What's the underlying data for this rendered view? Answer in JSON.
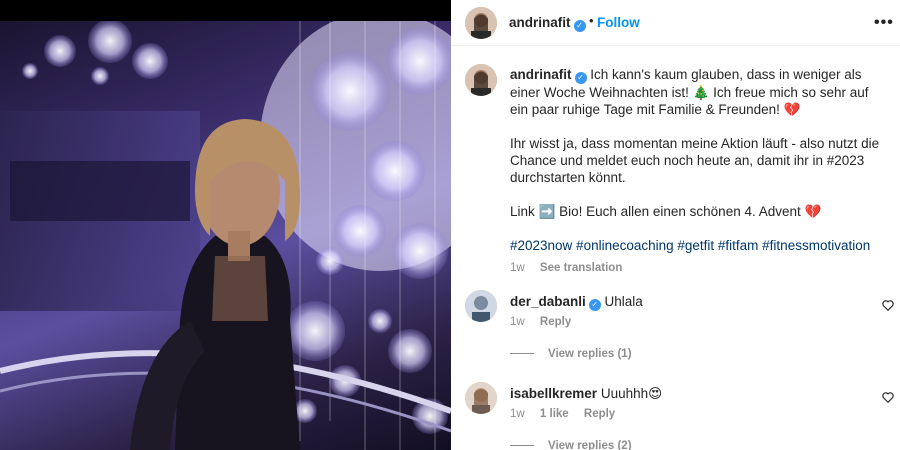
{
  "post": {
    "username": "andrinafit",
    "follow_label": "Follow",
    "more_label": "•••",
    "separator": "•"
  },
  "caption": {
    "username": "andrinafit",
    "para1_text": "Ich kann's kaum glauben, dass in weniger als einer Woche Weihnachten ist! 🎄 Ich freue mich so sehr auf ein paar ruhige Tage mit Familie & Freunden! 💔",
    "para2_text": "Ihr wisst ja, dass momentan meine Aktion läuft - also nutzt die Chance und meldet euch noch heute an, damit ihr in #2023 durchstarten könnt.",
    "para3_text": "Link ➡️ Bio! Euch allen einen schönen 4. Advent 💔",
    "hashtags": "#2023now #onlinecoaching #getfit #fitfam #fitnessmotivation",
    "time": "1w",
    "see_translation": "See translation"
  },
  "comments": [
    {
      "username": "der_dabanli",
      "text": "Uhlala",
      "time": "1w",
      "likes": "",
      "reply_label": "Reply",
      "view_replies": "View replies (1)"
    },
    {
      "username": "isabellkremer",
      "text": "Uuuhhh😍",
      "time": "1w",
      "likes": "1 like",
      "reply_label": "Reply",
      "view_replies": "View replies (2)"
    }
  ],
  "icons": {
    "verified": "verified-badge-icon",
    "heart": "heart-outline-icon",
    "more": "more-options-icon"
  },
  "colors": {
    "accent": "#0095f6",
    "verified": "#3897f0",
    "hashtag": "#00376b",
    "muted": "#8e8e8e"
  }
}
